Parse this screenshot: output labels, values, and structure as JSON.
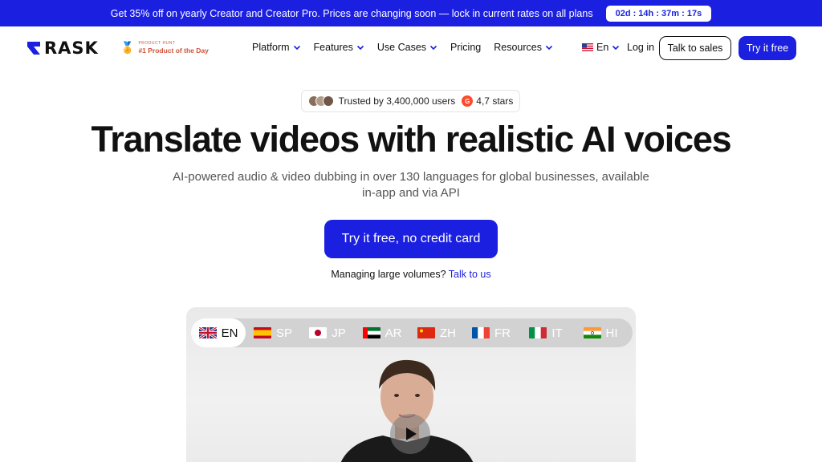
{
  "promo": {
    "text": "Get 35% off on yearly Creator and Creator Pro. Prices are changing soon — lock in current rates on all plans",
    "countdown": "02d : 14h : 37m : 17s"
  },
  "header": {
    "logo_text": "RASK",
    "product_hunt": {
      "small": "PRODUCT HUNT",
      "label": "#1 Product of the Day"
    },
    "nav": [
      "Platform",
      "Features",
      "Use Cases",
      "Pricing",
      "Resources"
    ],
    "language": "En",
    "login": "Log in",
    "talk_to_sales": "Talk to sales",
    "try_free": "Try it free"
  },
  "badge": {
    "trusted": "Trusted by 3,400,000 users",
    "rating": "4,7 stars"
  },
  "hero": {
    "title": "Translate videos with realistic AI voices",
    "subtitle": "AI-powered audio & video dubbing in over 130 languages for global businesses, available in-app and via API",
    "cta": "Try it free, no credit card",
    "manage_text": "Managing large volumes?",
    "manage_link": "Talk to us"
  },
  "video": {
    "languages": [
      {
        "code": "EN",
        "flag": "uk-flag",
        "active": true
      },
      {
        "code": "SP",
        "flag": "spain-flag",
        "active": false
      },
      {
        "code": "JP",
        "flag": "japan-flag",
        "active": false
      },
      {
        "code": "AR",
        "flag": "uae-flag",
        "active": false
      },
      {
        "code": "ZH",
        "flag": "china-flag",
        "active": false
      },
      {
        "code": "FR",
        "flag": "france-flag",
        "active": false
      },
      {
        "code": "IT",
        "flag": "italy-flag",
        "active": false
      },
      {
        "code": "HI",
        "flag": "india-flag",
        "active": false
      }
    ]
  },
  "colors": {
    "brand": "#1b1fe0",
    "text": "#111111",
    "muted": "#555555"
  }
}
